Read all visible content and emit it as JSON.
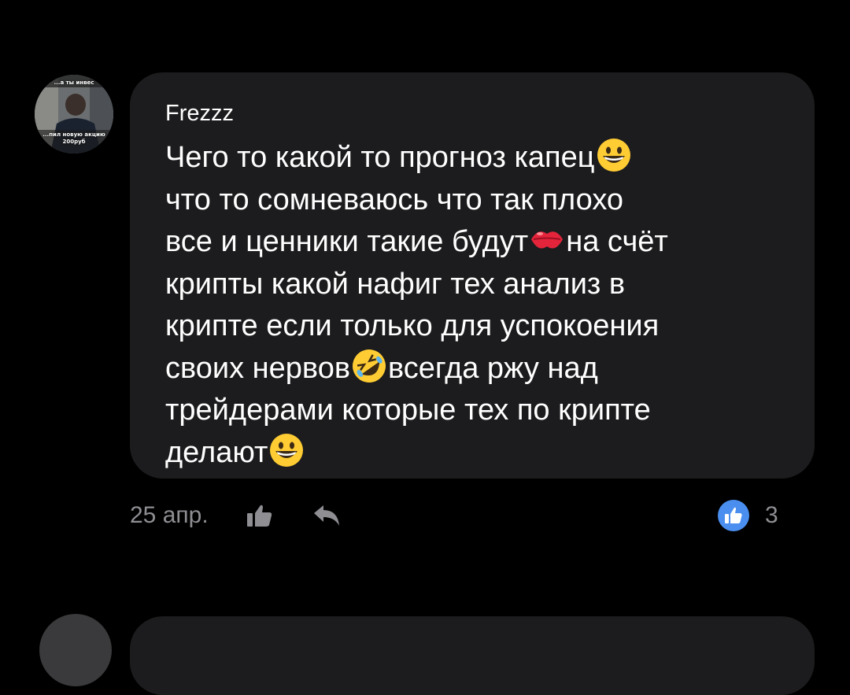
{
  "comment": {
    "avatar_caption_top": "...а ты инвес",
    "avatar_caption_bottom_1": "...пил новую акцию",
    "avatar_caption_bottom_2": "200руб",
    "author": "Frezzz",
    "message_lines": [
      "Чего то какой то прогноз капец",
      "что то сомневаюсь что так плохо",
      "все и ценники такие будут",
      "на счёт",
      "крипты какой нафиг тех анализ в",
      "крипте если только для успокоения",
      "своих нервов",
      "всегда ржу над",
      "трейдерами которые тех по крипте",
      "делают"
    ],
    "emojis": [
      "grinning-face",
      "kiss-mark",
      "rolling-on-floor-laughing",
      "grinning-face"
    ],
    "date": "25 апр.",
    "reaction_count": "3",
    "reaction_icon": "thumbs-up-icon"
  },
  "colors": {
    "background": "#000000",
    "bubble": "#1c1c1e",
    "text": "#ffffff",
    "meta_text": "#8e8e93",
    "reaction_badge": "#4a8ff0"
  }
}
